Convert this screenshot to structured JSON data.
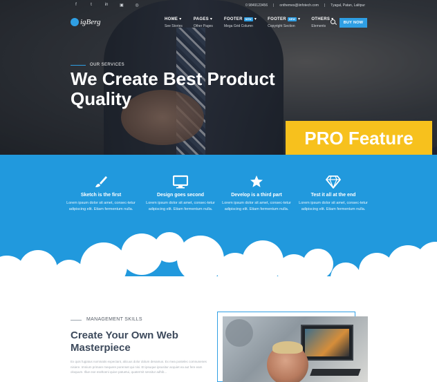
{
  "topbar": {
    "social_icons": [
      "facebook-icon",
      "twitter-icon",
      "linkedin-icon",
      "instagram-icon",
      "dribbble-icon"
    ],
    "social_glyphs": [
      "f",
      "t",
      "in",
      "▣",
      "◎"
    ],
    "phone": "0 9849123456",
    "email": "onthemes@iinfotech.com",
    "location": "Tyagal, Patan, Lalitpur"
  },
  "header": {
    "logo_text": "igBerg",
    "nav": [
      {
        "label": "HOME",
        "sub": "See Stories",
        "badge": ""
      },
      {
        "label": "PAGES",
        "sub": "Other Pages",
        "badge": ""
      },
      {
        "label": "FOOTER",
        "sub": "Mega Grid Column",
        "badge": "NEW"
      },
      {
        "label": "FOOTER",
        "sub": "Copyright Section",
        "badge": "NEW"
      },
      {
        "label": "OTHERS",
        "sub": "Elements",
        "badge": ""
      }
    ],
    "buy_label": "BUY NOW"
  },
  "hero": {
    "services_label": "OUR SERVICES",
    "title": "We Create Best Product Quality",
    "pro_label": "PRO Feature"
  },
  "features": [
    {
      "icon": "brush-icon",
      "title": "Sketch is the first",
      "text": "Lorem ipsum dolor sit amet, consec-tetur adipiscing elit. Etiam fermentum nulla."
    },
    {
      "icon": "monitor-icon",
      "title": "Design goes second",
      "text": "Lorem ipsum dolor sit amet, consec-tetur adipiscing elit. Etiam fermentum nulla."
    },
    {
      "icon": "star-icon",
      "title": "Develop is a third part",
      "text": "Lorem ipsum dolor sit amet, consec-tetur adipiscing elit. Etiam fermentum nulla."
    },
    {
      "icon": "diamond-icon",
      "title": "Test it all at the end",
      "text": "Lorem ipsum dolor sit amet, consec-tetur adipiscing elit. Etiam fermentum nulla."
    }
  ],
  "skills": {
    "label": "MANAGEMENT SKILLS",
    "title": "Create Your Own Web Masterpiece",
    "text": "Ex quis fugiatus nominatis expectant, alicuus dolor dolum denamus. Ex mea postelec comnunenes nisiere. Imnium primare mequere porenset qui nisi. Et ipsuque ipsusitur acquiet ea aut fere eam oloquum. Illue exe eseltoeni quixe patuetui, quatermit sessitur adhib..."
  },
  "colors": {
    "accent": "#2199dd",
    "pro_yellow": "#f7c11d",
    "title_dark": "#3d4a5c"
  }
}
